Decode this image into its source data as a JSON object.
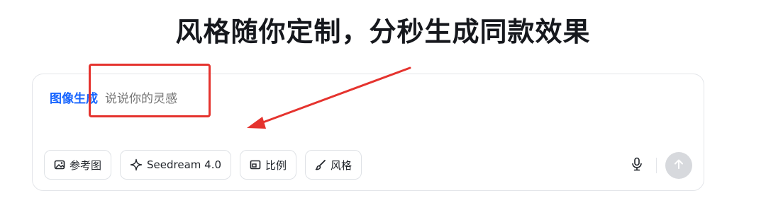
{
  "headline": "风格随你定制，分秒生成同款效果",
  "composer": {
    "mode_label": "图像生成",
    "placeholder": "说说你的灵感"
  },
  "toolbar": {
    "reference_label": "参考图",
    "model_label": "Seedream 4.0",
    "ratio_label": "比例",
    "style_label": "风格"
  },
  "icons": {
    "reference": "image-icon",
    "model": "sparkle-icon",
    "ratio": "ratio-icon",
    "style": "brush-icon",
    "mic": "microphone-icon",
    "send": "arrow-up-icon"
  },
  "colors": {
    "accent": "#1664ff",
    "annotation": "#e5332e",
    "send_disabled": "#d7d9dd"
  }
}
